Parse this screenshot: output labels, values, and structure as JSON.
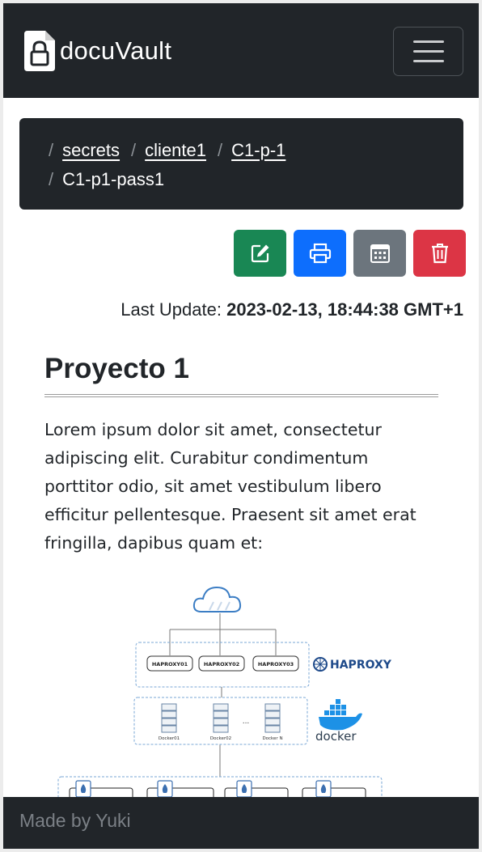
{
  "navbar": {
    "brand": "docuVault",
    "brand_icon": "file-lock-icon",
    "toggler_icon": "hamburger-menu-icon"
  },
  "breadcrumb": {
    "separator": "/",
    "items": [
      "secrets",
      "cliente1",
      "C1-p-1"
    ],
    "active": "C1-p1-pass1"
  },
  "actions": {
    "edit_icon": "edit-icon",
    "print_icon": "printer-icon",
    "calendar_icon": "calendar-icon",
    "delete_icon": "trash-icon"
  },
  "last_update": {
    "label": "Last Update:",
    "value": "2023-02-13, 18:44:38 GMT+1"
  },
  "document": {
    "title": "Proyecto 1",
    "paragraph": "Lorem ipsum dolor sit amet, consectetur adipiscing elit. Curabitur condimentum porttitor odio, sit amet vestibulum libero efficitur pellentesque. Praesent sit amet erat fringilla, dapibus quam et:",
    "diagram": {
      "haproxy_nodes": [
        "HAPROXY01",
        "HAPROXY02",
        "HAPROXY03"
      ],
      "haproxy_logo": "HAPROXY",
      "docker_nodes": [
        "Docker01",
        "Docker02",
        "Docker N"
      ],
      "docker_ellipsis": "...",
      "docker_logo": "docker"
    }
  },
  "footer": {
    "text": "Made by Yuki"
  },
  "colors": {
    "dark": "#212529",
    "edit": "#198754",
    "print": "#0d6efd",
    "calendar": "#6c757d",
    "delete": "#dc3545"
  }
}
